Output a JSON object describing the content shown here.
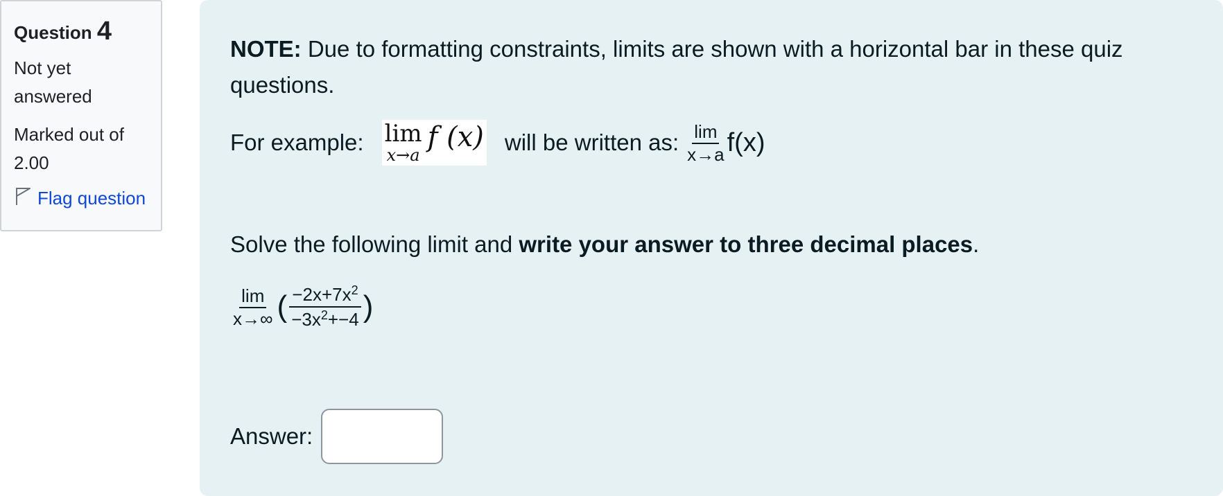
{
  "info": {
    "question_label": "Question",
    "question_number": "4",
    "status": "Not yet answered",
    "marked_out_of_label": "Marked out of",
    "marked_out_of_value": "2.00",
    "flag_label": "Flag question"
  },
  "content": {
    "note_prefix": "NOTE:",
    "note_text": " Due to formatting constraints, limits are shown with a horizontal bar in these quiz questions.",
    "example_label": "For example:",
    "example_lim": "lim",
    "example_sub": "x→a",
    "example_fx": "f (x)",
    "written_as_label": "will be written as:",
    "written_lim": "lim",
    "written_sub": "x→a",
    "written_fx": "f(x)",
    "instruction_prefix": "Solve the following limit and ",
    "instruction_bold": "write your answer to three decimal places",
    "instruction_suffix": ".",
    "expr_lim": "lim",
    "expr_sub": "x→∞",
    "expr_num_a": "−2x+7x",
    "expr_num_exp": "2",
    "expr_den_a": "−3x",
    "expr_den_exp": "2",
    "expr_den_b": "+−4",
    "answer_label": "Answer:",
    "answer_value": ""
  }
}
